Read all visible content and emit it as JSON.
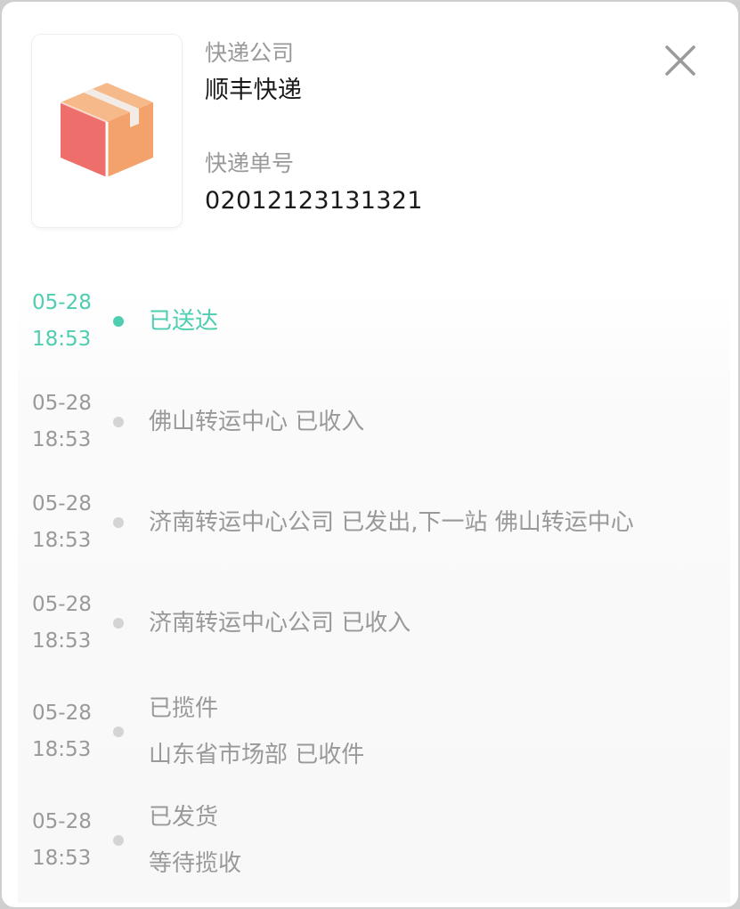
{
  "header": {
    "company_label": "快递公司",
    "company_value": "顺丰快递",
    "tracking_label": "快递单号",
    "tracking_value": "02012123131321",
    "package_icon": "package-box-icon",
    "close_icon": "close-icon"
  },
  "colors": {
    "accent": "#4ecdb0",
    "muted": "#999999",
    "dot": "#d4d4d4"
  },
  "timeline": [
    {
      "date": "05-28",
      "time": "18:53",
      "lines": [
        "已送达"
      ],
      "active": true
    },
    {
      "date": "05-28",
      "time": "18:53",
      "lines": [
        "佛山转运中心 已收入"
      ],
      "active": false
    },
    {
      "date": "05-28",
      "time": "18:53",
      "lines": [
        "济南转运中心公司 已发出,下一站 佛山转运中心"
      ],
      "active": false
    },
    {
      "date": "05-28",
      "time": "18:53",
      "lines": [
        "济南转运中心公司 已收入"
      ],
      "active": false
    },
    {
      "date": "05-28",
      "time": "18:53",
      "lines": [
        "已揽件",
        "山东省市场部 已收件"
      ],
      "active": false
    },
    {
      "date": "05-28",
      "time": "18:53",
      "lines": [
        "已发货",
        "等待揽收"
      ],
      "active": false
    }
  ]
}
